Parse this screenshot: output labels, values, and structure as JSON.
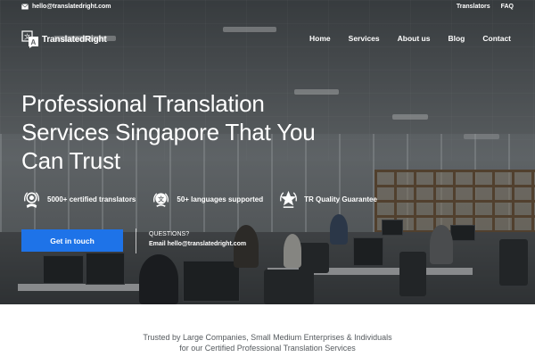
{
  "topbar": {
    "email": "hello@translatedright.com",
    "links": [
      "Translators",
      "FAQ"
    ]
  },
  "brand": {
    "name": "TranslatedRight",
    "logo_glyph": "A"
  },
  "nav": {
    "items": [
      "Home",
      "Services",
      "About us",
      "Blog",
      "Contact"
    ]
  },
  "hero": {
    "headline_lines": [
      "Professional Translation",
      "Services Singapore That You",
      "Can Trust"
    ],
    "features": [
      {
        "icon": "certified-badge-icon",
        "text": "5000+ certified translators"
      },
      {
        "icon": "languages-badge-icon",
        "text": "50+ languages supported"
      },
      {
        "icon": "quality-star-icon",
        "text": "TR Quality Guarantee"
      }
    ],
    "cta_label": "Get in touch",
    "questions_label": "QUESTIONS?",
    "questions_email": "Email hello@translatedright.com"
  },
  "trusted": {
    "line1": "Trusted by Large Companies, Small Medium Enterprises & Individuals",
    "line2": "for our Certified Professional Translation Services"
  },
  "colors": {
    "accent": "#1e73e8",
    "text_light": "#ffffff",
    "muted_text": "#555a5e"
  }
}
